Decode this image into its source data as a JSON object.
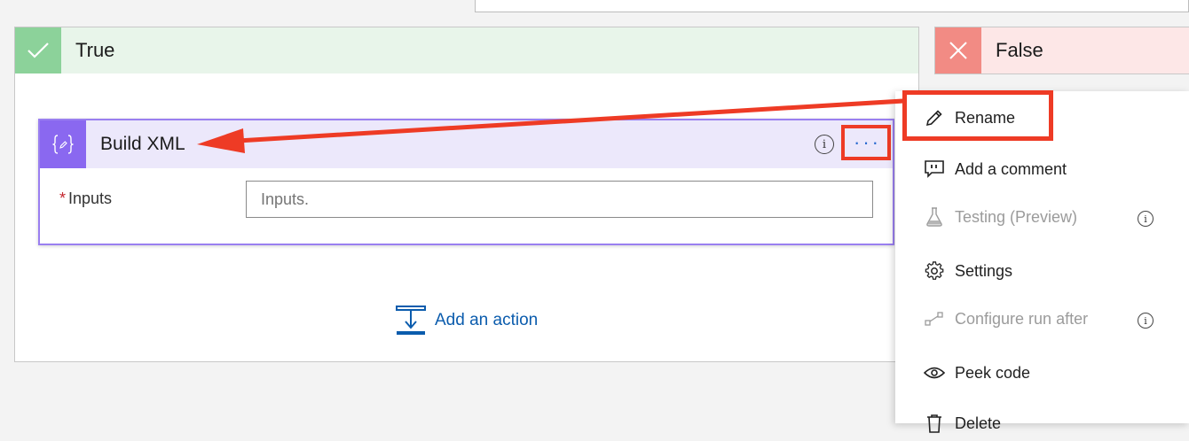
{
  "branches": {
    "true_label": "True",
    "false_label": "False"
  },
  "action_card": {
    "title": "Build XML",
    "info_glyph": "i",
    "more_glyph": "···",
    "field_required_mark": "*",
    "field_label": "Inputs",
    "field_placeholder": "Inputs.",
    "icon": "code-braces-icon"
  },
  "add_action": {
    "label": "Add an action"
  },
  "context_menu": {
    "items": [
      {
        "label": "Rename",
        "icon": "pencil-icon",
        "enabled": true
      },
      {
        "label": "Add a comment",
        "icon": "comment-icon",
        "enabled": true
      },
      {
        "label": "Testing (Preview)",
        "icon": "flask-icon",
        "enabled": false,
        "info": "i"
      },
      {
        "label": "Settings",
        "icon": "gear-icon",
        "enabled": true
      },
      {
        "label": "Configure run after",
        "icon": "run-after-icon",
        "enabled": false,
        "info": "i"
      },
      {
        "label": "Peek code",
        "icon": "eye-icon",
        "enabled": true
      },
      {
        "label": "Delete",
        "icon": "trash-icon",
        "enabled": true
      }
    ]
  },
  "colors": {
    "true_accent": "#8cd29a",
    "false_accent": "#f28b84",
    "action_accent": "#8a68f0",
    "annotation_red": "#ee3b25",
    "link_blue": "#0b5cad"
  }
}
